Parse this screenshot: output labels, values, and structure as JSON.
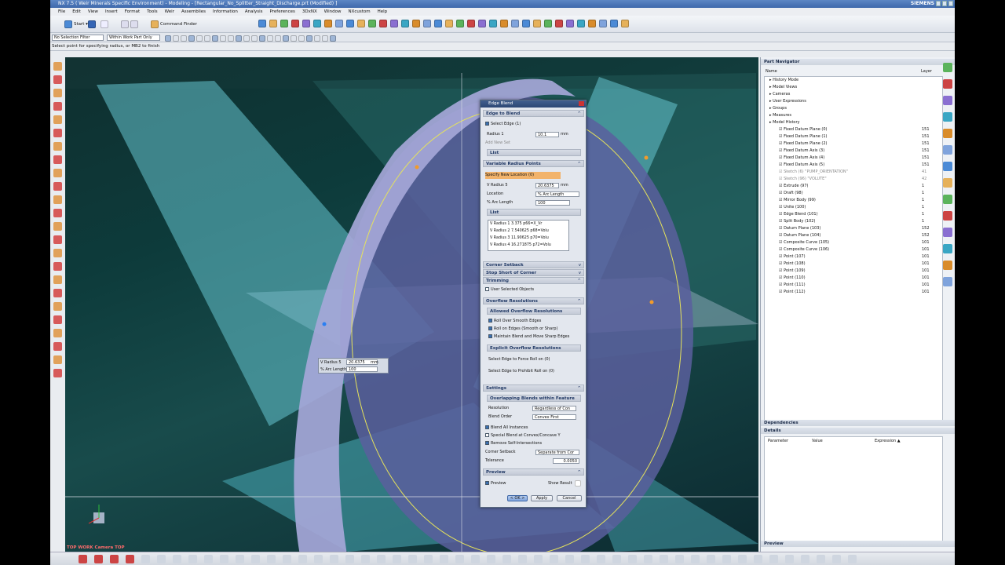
{
  "window": {
    "title": "NX 7.5 ( Weir Minerals Specific Environment) - Modeling - [Rectangular_No_Splitter_Straight_Discharge.prt (Modified) ]",
    "brand": "SIEMENS"
  },
  "menu": [
    "File",
    "Edit",
    "View",
    "Insert",
    "Format",
    "Tools",
    "Weir",
    "Assemblies",
    "Information",
    "Analysis",
    "Preferences",
    "3DxNX",
    "Window",
    "NXcustom",
    "Help"
  ],
  "toolbar": {
    "start": "Start ▾",
    "command_finder": "Command Finder"
  },
  "selection": {
    "filter": "No Selection Filter",
    "scope": "Within Work Part Only"
  },
  "status": "Select point for specifying radius, or MB2 to finish",
  "viewport": {
    "label": "TOP WORK Camera TOP",
    "floating_radius_label": "V Radius 5",
    "floating_radius_value": "20.6375",
    "floating_unit": "mm",
    "floating_arc_label": "% Arc Length",
    "floating_arc_value": "100"
  },
  "dialog": {
    "title": "Edge Blend",
    "edge_to_blend": "Edge to Blend",
    "select_edge": "Select Edge (1)",
    "radius1_label": "Radius 1",
    "radius1_value": "10.1",
    "unit": "mm",
    "add_new_set": "Add New Set",
    "list": "List",
    "variable_radius_points": "Variable Radius Points",
    "specify_new_location": "Specify New Location (0)",
    "v_radius5_label": "V Radius 5",
    "v_radius5_value": "20.6375",
    "location_label": "Location",
    "location_value": "% Arc Length",
    "arc_label": "% Arc Length",
    "arc_value": "100",
    "list_rows": [
      "V Radius 1  3.375      p66=X_Vr",
      "V Radius 2  7.540625   p68=Volu",
      "V Radius 3  11.90625   p70=Volu",
      "V Radius 4  16.271875  p72=Volu"
    ],
    "corner_setback": "Corner Setback",
    "stop_short": "Stop Short of Corner",
    "trimming": "Trimming",
    "user_selected_objects": "User Selected Objects",
    "overflow_resolutions": "Overflow Resolutions",
    "allowed_overflow": "Allowed Overflow Resolutions",
    "roll_over": "Roll Over Smooth Edges",
    "roll_on": "Roll on Edges (Smooth or Sharp)",
    "maintain": "Maintain Blend and Move Sharp Edges",
    "explicit_overflow": "Explicit Overflow Resolutions",
    "force_roll": "Select Edge to Force Roll on (0)",
    "prohibit_roll": "Select Edge to Prohibit Roll on (0)",
    "settings": "Settings",
    "overlapping": "Overlapping Blends within Feature",
    "resolution_label": "Resolution",
    "resolution_value": "Regardless of Con",
    "blend_order_label": "Blend Order",
    "blend_order_value": "Convex First",
    "blend_all": "Blend All Instances",
    "special_blend": "Special Blend at Convex/Concave Y",
    "remove_self": "Remove Self-Intersections",
    "corner_setback_label": "Corner Setback",
    "corner_setback_value": "Separate from Cor",
    "tolerance_label": "Tolerance",
    "tolerance_value": "0.0050",
    "preview": "Preview",
    "preview_check": "Preview",
    "show_result": "Show Result",
    "ok": "< OK >",
    "apply": "Apply",
    "cancel": "Cancel"
  },
  "navigator": {
    "title": "Part Navigator",
    "col_name": "Name",
    "col_layer": "Layer",
    "rows": [
      {
        "name": "History Mode",
        "layer": "",
        "indent": 1,
        "grey": false
      },
      {
        "name": "Model Views",
        "layer": "",
        "indent": 1,
        "grey": false
      },
      {
        "name": "Cameras",
        "layer": "",
        "indent": 1,
        "grey": false
      },
      {
        "name": "User Expressions",
        "layer": "",
        "indent": 1,
        "grey": false
      },
      {
        "name": "Groups",
        "layer": "",
        "indent": 1,
        "grey": false
      },
      {
        "name": "Measures",
        "layer": "",
        "indent": 1,
        "grey": false
      },
      {
        "name": "Model History",
        "layer": "",
        "indent": 1,
        "grey": false
      },
      {
        "name": "Fixed Datum Plane (0)",
        "layer": "151",
        "indent": 3,
        "grey": false
      },
      {
        "name": "Fixed Datum Plane (1)",
        "layer": "151",
        "indent": 3,
        "grey": false
      },
      {
        "name": "Fixed Datum Plane (2)",
        "layer": "151",
        "indent": 3,
        "grey": false
      },
      {
        "name": "Fixed Datum Axis (3)",
        "layer": "151",
        "indent": 3,
        "grey": false
      },
      {
        "name": "Fixed Datum Axis (4)",
        "layer": "151",
        "indent": 3,
        "grey": false
      },
      {
        "name": "Fixed Datum Axis (5)",
        "layer": "151",
        "indent": 3,
        "grey": false
      },
      {
        "name": "Sketch (6) \"PUMP_ORIENTATION\"",
        "layer": "41",
        "indent": 3,
        "grey": true
      },
      {
        "name": "Sketch (96) \"VOLUTE\"",
        "layer": "42",
        "indent": 3,
        "grey": true
      },
      {
        "name": "Extrude (97)",
        "layer": "1",
        "indent": 3,
        "grey": false
      },
      {
        "name": "Draft (98)",
        "layer": "1",
        "indent": 3,
        "grey": false
      },
      {
        "name": "Mirror Body (99)",
        "layer": "1",
        "indent": 3,
        "grey": false
      },
      {
        "name": "Unite (100)",
        "layer": "1",
        "indent": 3,
        "grey": false
      },
      {
        "name": "Edge Blend (101)",
        "layer": "1",
        "indent": 3,
        "grey": false
      },
      {
        "name": "Split Body (102)",
        "layer": "1",
        "indent": 3,
        "grey": false
      },
      {
        "name": "Datum Plane (103)",
        "layer": "152",
        "indent": 3,
        "grey": false
      },
      {
        "name": "Datum Plane (104)",
        "layer": "152",
        "indent": 3,
        "grey": false
      },
      {
        "name": "Composite Curve (105)",
        "layer": "101",
        "indent": 3,
        "grey": false
      },
      {
        "name": "Composite Curve (106)",
        "layer": "101",
        "indent": 3,
        "grey": false
      },
      {
        "name": "Point (107)",
        "layer": "101",
        "indent": 3,
        "grey": false
      },
      {
        "name": "Point (108)",
        "layer": "101",
        "indent": 3,
        "grey": false
      },
      {
        "name": "Point (109)",
        "layer": "101",
        "indent": 3,
        "grey": false
      },
      {
        "name": "Point (110)",
        "layer": "101",
        "indent": 3,
        "grey": false
      },
      {
        "name": "Point (111)",
        "layer": "101",
        "indent": 3,
        "grey": false
      },
      {
        "name": "Point (112)",
        "layer": "101",
        "indent": 3,
        "grey": false
      }
    ],
    "dependencies": "Dependencies",
    "details": "Details",
    "detail_cols": [
      "Parameter",
      "Value",
      "Expression ▲"
    ],
    "preview": "Preview"
  }
}
